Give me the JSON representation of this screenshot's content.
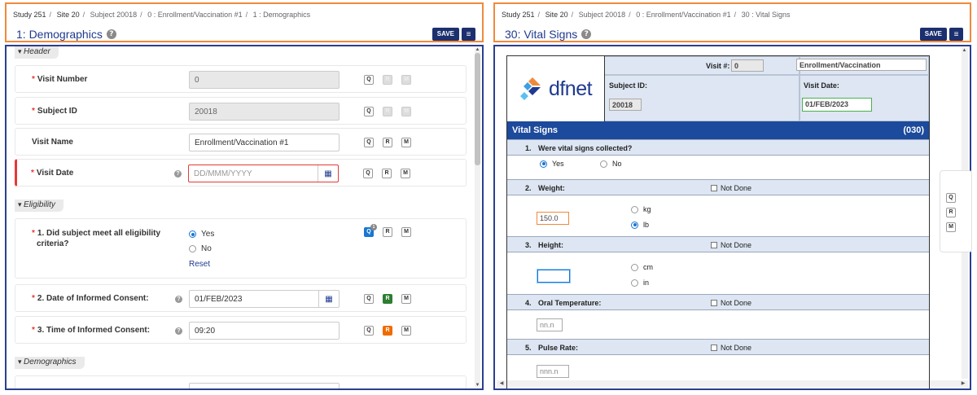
{
  "left": {
    "breadcrumb": [
      "Study 251",
      "Site 20",
      "Subject 20018",
      "0 : Enrollment/Vaccination #1",
      "1 : Demographics"
    ],
    "title": "1: Demographics",
    "save_label": "SAVE",
    "sections": {
      "header": "Header",
      "eligibility": "Eligibility",
      "demographics": "Demographics"
    },
    "fields": {
      "visit_number": {
        "label": "Visit Number",
        "value": "0"
      },
      "subject_id": {
        "label": "Subject ID",
        "value": "20018"
      },
      "visit_name": {
        "label": "Visit Name",
        "value": "Enrollment/Vaccination #1"
      },
      "visit_date": {
        "label": "Visit Date",
        "placeholder": "DD/MMM/YYYY"
      },
      "eligibility_q": {
        "label_line1": "1. Did subject meet all eligibility",
        "label_line2": "criteria?",
        "opt_yes": "Yes",
        "opt_no": "No",
        "selected": "Yes",
        "reset": "Reset",
        "query_count": "1"
      },
      "consent_date": {
        "label": "2. Date of Informed Consent:",
        "value": "01/FEB/2023"
      },
      "consent_time": {
        "label": "3. Time of Informed Consent:",
        "value": "09:20"
      }
    },
    "qrm": {
      "q": "Q",
      "r": "R",
      "m": "M"
    },
    "help": "?"
  },
  "right": {
    "breadcrumb": [
      "Study 251",
      "Site 20",
      "Subject 20018",
      "0 : Enrollment/Vaccination #1",
      "30 : Vital Signs"
    ],
    "title": "30: Vital Signs",
    "save_label": "SAVE",
    "logo_text": "dfnet",
    "visit_num_label": "Visit #:",
    "visit_num_value": "0",
    "visit_name_value": "Enrollment/Vaccination",
    "subject_id_label": "Subject ID:",
    "subject_id_value": "20018",
    "visit_date_label": "Visit Date:",
    "visit_date_value": "01/FEB/2023",
    "section_title": "Vital Signs",
    "section_code": "(030)",
    "not_done": "Not Done",
    "questions": [
      {
        "num": "1.",
        "text": "Were vital signs collected?",
        "opt_yes": "Yes",
        "opt_no": "No",
        "selected": "Yes"
      },
      {
        "num": "2.",
        "text": "Weight:",
        "value": "150.0",
        "unit1": "kg",
        "unit2": "lb",
        "selected_unit": "lb"
      },
      {
        "num": "3.",
        "text": "Height:",
        "value": "",
        "unit1": "cm",
        "unit2": "in"
      },
      {
        "num": "4.",
        "text": "Oral Temperature:",
        "placeholder": "nn.n"
      },
      {
        "num": "5.",
        "text": "Pulse Rate:",
        "placeholder": "nnn.n"
      }
    ],
    "qrm": {
      "q": "Q",
      "r": "R",
      "m": "M"
    }
  }
}
